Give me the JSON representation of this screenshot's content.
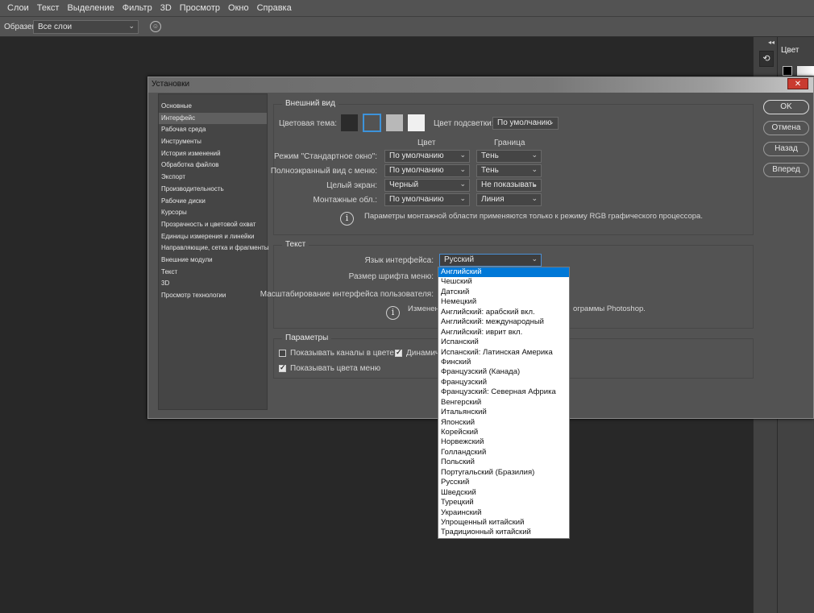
{
  "menubar": [
    "Слои",
    "Текст",
    "Выделение",
    "Фильтр",
    "3D",
    "Просмотр",
    "Окно",
    "Справка"
  ],
  "optionsbar": {
    "sample_label": "Образец:",
    "sample_value": "Все слои"
  },
  "right_panel": {
    "history_icon": "history-icon",
    "color_tab": "Цвет"
  },
  "dialog": {
    "title": "Установки",
    "close_label": "✕",
    "sidebar": [
      "Основные",
      "Интерфейс",
      "Рабочая среда",
      "Инструменты",
      "История изменений",
      "Обработка файлов",
      "Экспорт",
      "Производительность",
      "Рабочие диски",
      "Курсоры",
      "Прозрачность и цветовой охват",
      "Единицы измерения и линейки",
      "Направляющие, сетка и фрагменты",
      "Внешние модули",
      "Текст",
      "3D",
      "Просмотр технологии"
    ],
    "sidebar_active": 1,
    "appearance": {
      "title": "Внешний вид",
      "color_theme_label": "Цветовая тема:",
      "theme_colors": [
        "#2b2b2b",
        "#535353",
        "#b8b8b8",
        "#f0f0f0"
      ],
      "highlight_label": "Цвет подсветки:",
      "highlight_value": "По умолчанию",
      "col_color": "Цвет",
      "col_border": "Граница",
      "rows": [
        {
          "label": "Режим \"Стандартное окно\":",
          "color": "По умолчанию",
          "border": "Тень"
        },
        {
          "label": "Полноэкранный вид с меню:",
          "color": "По умолчанию",
          "border": "Тень"
        },
        {
          "label": "Целый экран:",
          "color": "Черный",
          "border": "Не показывать"
        },
        {
          "label": "Монтажные обл.:",
          "color": "По умолчанию",
          "border": "Линия"
        }
      ],
      "info": "Параметры монтажной области применяются только к режиму RGB графического процессора."
    },
    "text_group": {
      "title": "Текст",
      "language_label": "Язык интерфейса:",
      "language_value": "Русский",
      "font_size_label": "Размер шрифта меню:",
      "scaling_label": "Масштабирование интерфейса пользователя:",
      "info_left": "Изменен",
      "info_right": "ограммы Photoshop."
    },
    "params": {
      "title": "Параметры",
      "show_channels_color": "Показывать каналы в цвете",
      "dynamic": "Динамиче",
      "show_menu_colors": "Показывать цвета меню"
    },
    "buttons": {
      "ok": "OK",
      "cancel": "Отмена",
      "back": "Назад",
      "forward": "Вперед"
    }
  },
  "language_options": [
    "Английский",
    "Чешский",
    "Датский",
    "Немецкий",
    "Английский: арабский вкл.",
    "Английский: международный",
    "Английский: иврит вкл.",
    "Испанский",
    "Испанский: Латинская Америка",
    "Финский",
    "Французский (Канада)",
    "Французский",
    "Французский: Северная Африка",
    "Венгерский",
    "Итальянский",
    "Японский",
    "Корейский",
    "Норвежский",
    "Голландский",
    "Польский",
    "Португальский (Бразилия)",
    "Русский",
    "Шведский",
    "Турецкий",
    "Украинский",
    "Упрощенный китайский",
    "Традиционный китайский"
  ],
  "language_highlighted": 0
}
